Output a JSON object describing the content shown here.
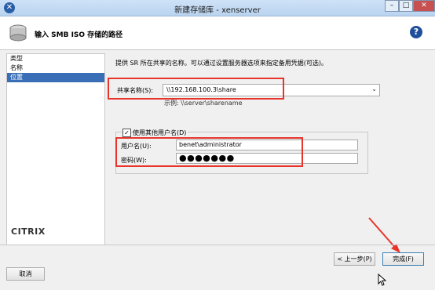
{
  "window": {
    "title": "新建存储库 - xenserver",
    "minimize": "–",
    "maximize": "□",
    "close": "✕"
  },
  "header": {
    "title": "输入 SMB ISO 存储的路径",
    "help": "?"
  },
  "sidebar": {
    "items": [
      {
        "label": "类型",
        "active": false
      },
      {
        "label": "名称",
        "active": false
      },
      {
        "label": "位置",
        "active": true
      }
    ],
    "brand": "CITRIX"
  },
  "main": {
    "description": "提供 SR 所在共享的名称。可以通过设置服务器选项来指定备用凭据(可选)。",
    "share": {
      "label": "共享名称(S):",
      "value": "\\\\192.168.100.3\\share",
      "hint": "示例: \\\\server\\sharename"
    },
    "credentials": {
      "checkbox_label": "使用其他用户名(D)",
      "checked": true,
      "username_label": "用户名(U):",
      "username_value": "benet\\administrator",
      "password_label": "密码(W):",
      "password_value": "●●●●●●●"
    }
  },
  "buttons": {
    "prev": "< 上一步(P)",
    "finish": "完成(F)",
    "cancel": "取消"
  },
  "colors": {
    "annotation_red": "#e8342a",
    "selection_blue": "#3a6fb8"
  }
}
